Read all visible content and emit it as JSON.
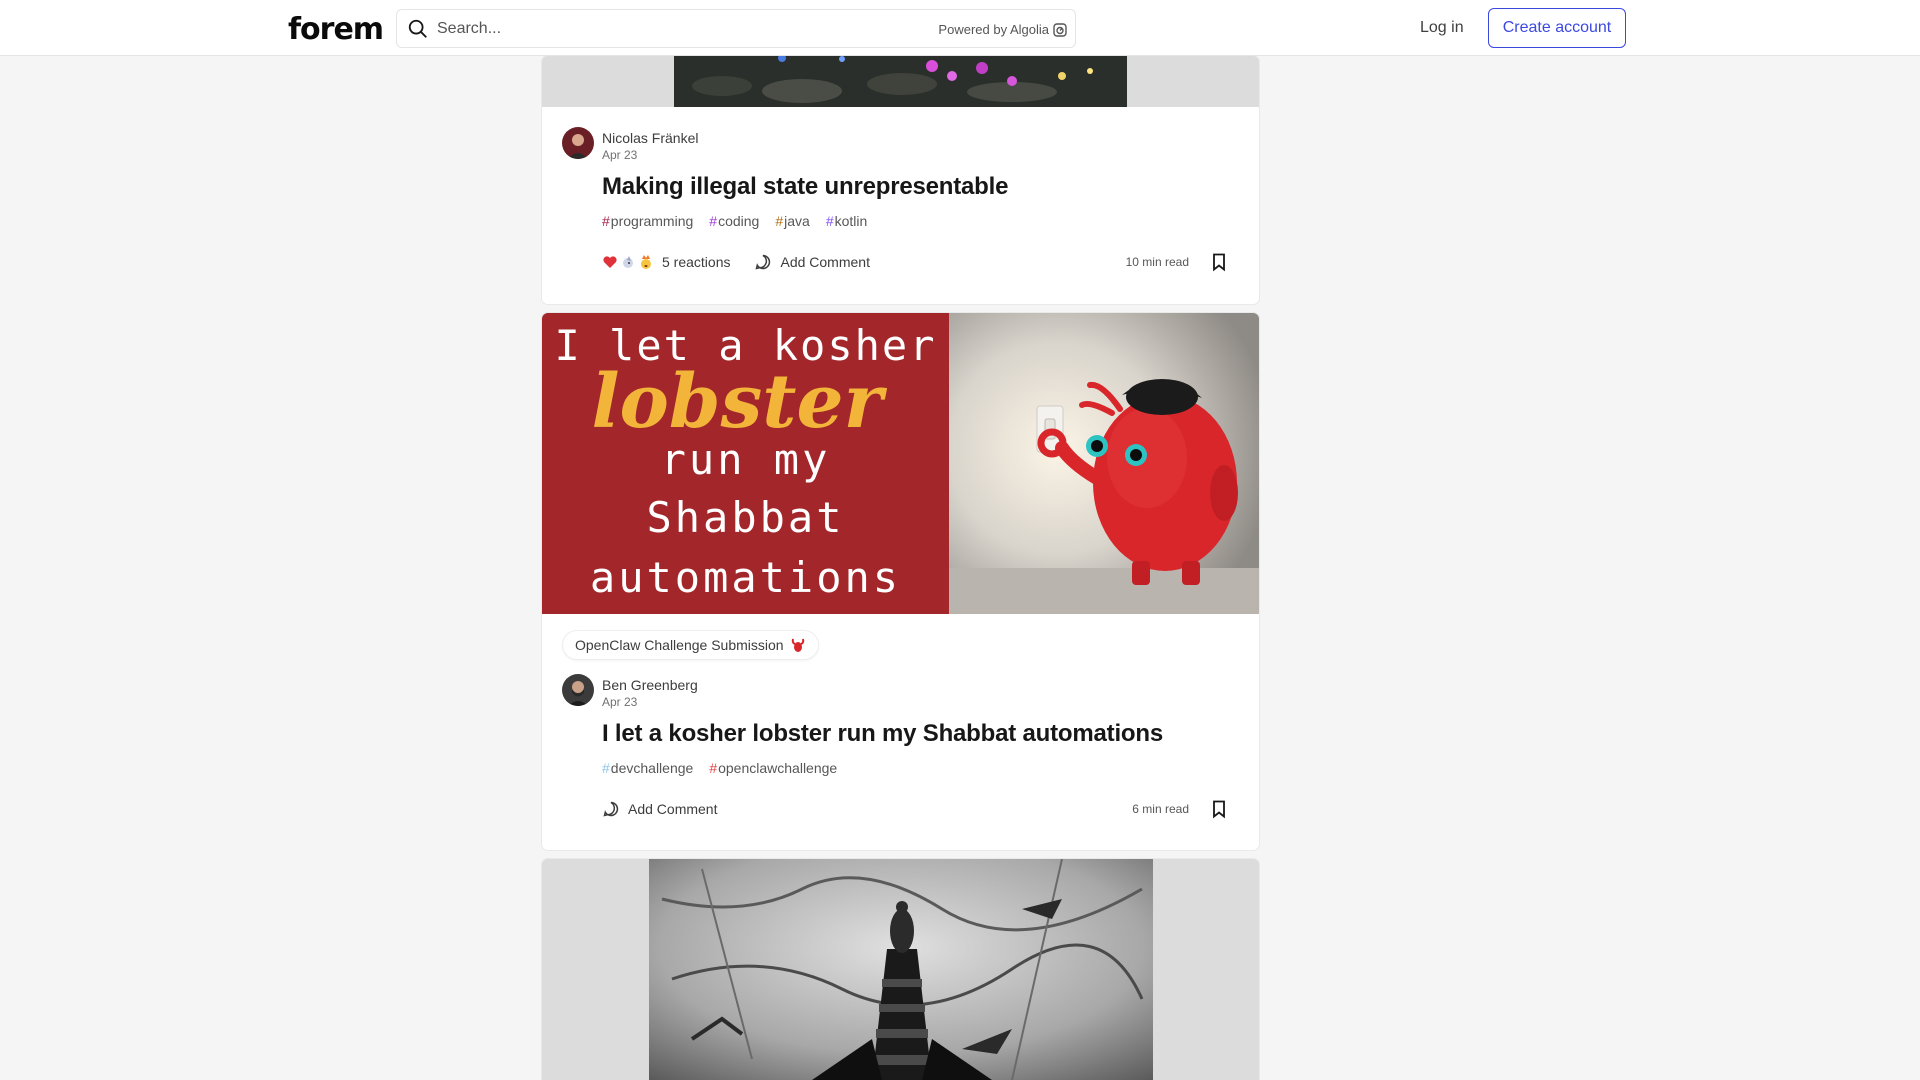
{
  "header": {
    "logo": "forem",
    "search_placeholder": "Search...",
    "powered_by": "Powered by Algolia",
    "login": "Log in",
    "create_account": "Create account"
  },
  "posts": [
    {
      "author": "Nicolas Fränkel",
      "date": "Apr 23",
      "title": "Making illegal state unrepresentable",
      "tags": [
        {
          "hash": "#",
          "name": "programming",
          "color": "#a4254b"
        },
        {
          "hash": "#",
          "name": "coding",
          "color": "#9b3bd6"
        },
        {
          "hash": "#",
          "name": "java",
          "color": "#b07219"
        },
        {
          "hash": "#",
          "name": "kotlin",
          "color": "#7f52ff"
        }
      ],
      "reactions": "5 reactions",
      "comment": "Add Comment",
      "read_time": "10 min read"
    },
    {
      "badge": "OpenClaw Challenge Submission",
      "cover_text": {
        "line1": "I let a kosher",
        "line2": "lobster",
        "line3": "run my",
        "line4": "Shabbat",
        "line5": "automations"
      },
      "author": "Ben Greenberg",
      "date": "Apr 23",
      "title": "I let a kosher lobster run my Shabbat automations",
      "tags": [
        {
          "hash": "#",
          "name": "devchallenge",
          "color": "#8ec5e8"
        },
        {
          "hash": "#",
          "name": "openclawchallenge",
          "color": "#e04646"
        }
      ],
      "comment": "Add Comment",
      "read_time": "6 min read"
    }
  ],
  "colors": {
    "accent": "#3b49df",
    "cover_red": "#a3262a",
    "lobster_yellow": "#f2b53a"
  }
}
